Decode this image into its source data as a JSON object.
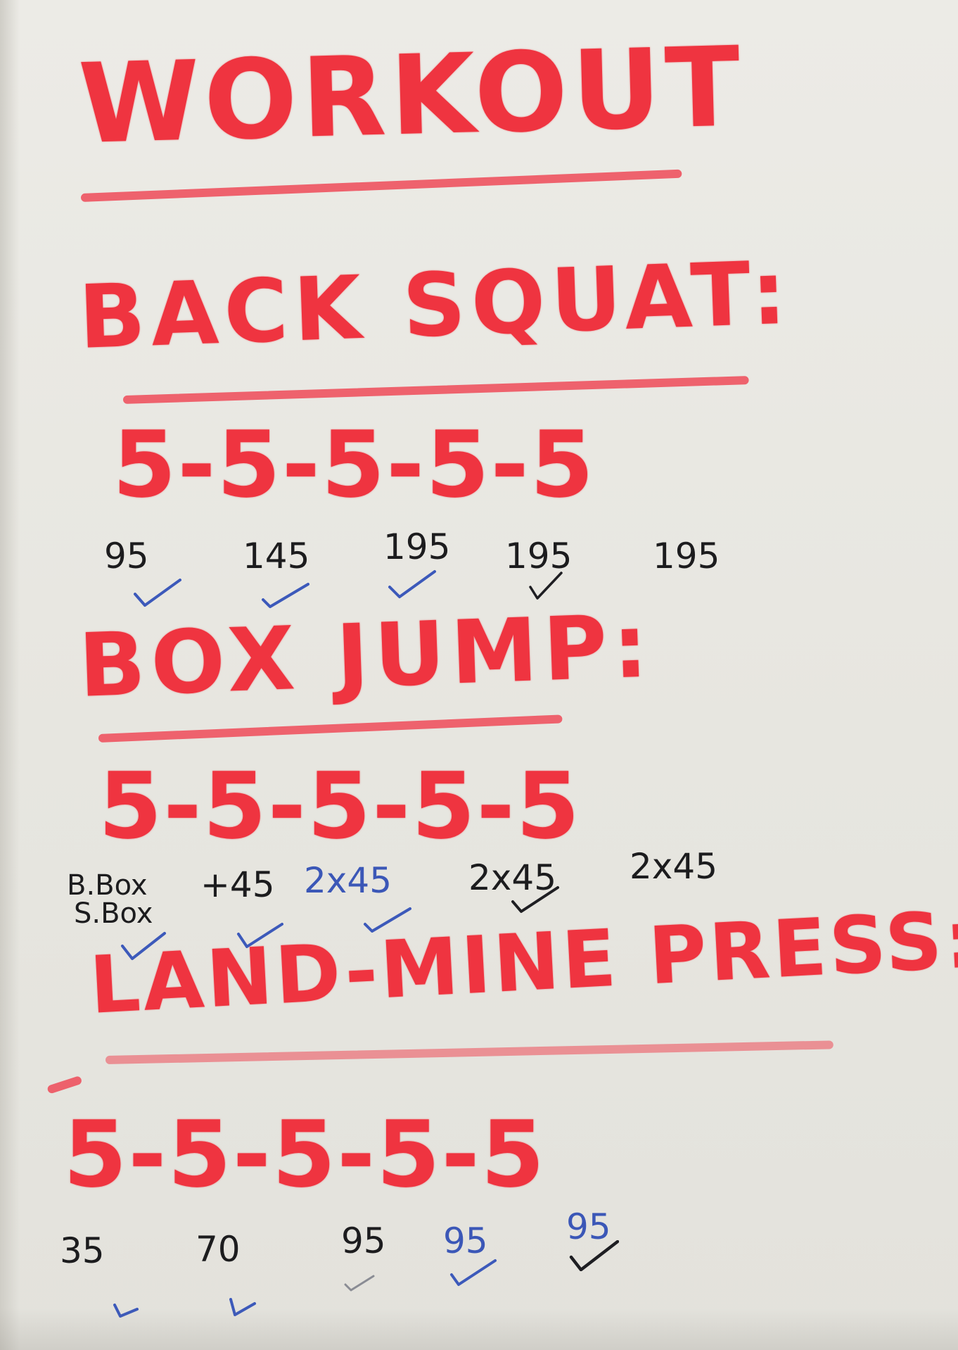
{
  "board": {
    "title": "WORKOUT",
    "ink_colors": {
      "red_marker": "#ef3440",
      "black_marker": "#1c1c1e",
      "blue_marker": "#3b57b7"
    },
    "sections": [
      {
        "heading": "BACK SQUAT:",
        "reps": "5-5-5-5-5",
        "weights": [
          "95",
          "145",
          "195",
          "195",
          "195"
        ],
        "checks": [
          {
            "mark": "check-icon",
            "color": "blue"
          },
          {
            "mark": "check-icon",
            "color": "blue"
          },
          {
            "mark": "check-icon",
            "color": "blue"
          },
          {
            "mark": "check-icon",
            "color": "black"
          }
        ]
      },
      {
        "heading": "BOX JUMP:",
        "reps": "5-5-5-5-5",
        "weights": [
          "B.Box",
          "S.Box",
          "+45",
          "2x45",
          "2x45",
          "2x45"
        ],
        "checks": [
          {
            "mark": "check-icon",
            "color": "blue"
          },
          {
            "mark": "check-icon",
            "color": "blue"
          },
          {
            "mark": "check-icon",
            "color": "blue"
          },
          {
            "mark": "check-icon",
            "color": "black"
          }
        ]
      },
      {
        "heading": "LAND-MINE PRESS:",
        "reps": "5-5-5-5-5",
        "weights": [
          "35",
          "70",
          "95",
          "95",
          "95"
        ],
        "checks": [
          {
            "mark": "check-icon",
            "color": "blue"
          },
          {
            "mark": "check-icon",
            "color": "blue"
          },
          {
            "mark": "check-icon",
            "color": "faint"
          },
          {
            "mark": "check-icon",
            "color": "blue"
          },
          {
            "mark": "check-icon",
            "color": "black"
          }
        ]
      }
    ]
  }
}
